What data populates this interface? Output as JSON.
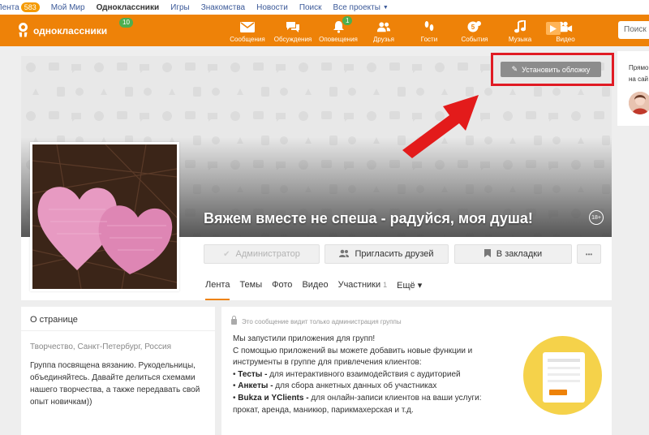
{
  "topbar": {
    "links": [
      "Лента",
      "Мой Мир",
      "Одноклассники",
      "Игры",
      "Знакомства",
      "Новости",
      "Поиск",
      "Все проекты"
    ],
    "feed_count": "583"
  },
  "header": {
    "logo_text": "одноклассники",
    "logo_badge": "10",
    "nav": [
      {
        "label": "Сообщения",
        "icon": "envelope-icon"
      },
      {
        "label": "Обсуждения",
        "icon": "chat-bubbles-icon"
      },
      {
        "label": "Оповещения",
        "icon": "bell-icon",
        "badge": "1"
      },
      {
        "label": "Друзья",
        "icon": "people-icon"
      },
      {
        "label": "Гости",
        "icon": "footprints-icon"
      },
      {
        "label": "События",
        "icon": "events-icon",
        "badge_inline": "5"
      },
      {
        "label": "Музыка",
        "icon": "music-note-icon"
      },
      {
        "label": "Видео",
        "icon": "video-camera-icon"
      }
    ],
    "search_placeholder": "Поиск"
  },
  "cover": {
    "set_cover_label": "Установить обложку",
    "group_title": "Вяжем вместе не спеша - радуйся, моя душа!",
    "age_rating": "18+"
  },
  "actions": {
    "admin_label": "Администратор",
    "invite_label": "Пригласить друзей",
    "bookmark_label": "В закладки",
    "more_label": "•••"
  },
  "tabs": {
    "feed": "Лента",
    "topics": "Темы",
    "photo": "Фото",
    "video": "Видео",
    "members": "Участники",
    "members_count": "1",
    "more": "Ещё ▾"
  },
  "about": {
    "heading": "О странице",
    "location": "Творчество, Санкт-Петербург, Россия",
    "description": "Группа посвящена вязанию. Рукодельницы, объединяйтесь. Давайте делиться схемами нашего творчества, а также передавать свой опыт новичкам))"
  },
  "message": {
    "admin_note": "Это сообщение видит только администрация группы",
    "intro1": "Мы запустили приложения для групп!",
    "intro2": "С помощью приложений вы можете добавить новые функции и инструменты в группе для привлечения клиентов:",
    "item1_bold": "Тесты -",
    "item1_text": " для интерактивного взаимодействия с аудиторией",
    "item2_bold": "Анкеты -",
    "item2_text": " для сбора анкетных данных об участниках",
    "item3_bold": "Bukza и YClients -",
    "item3_text": " для онлайн-записи клиентов на ваши услуги: прокат, аренда, маникюр, парикмахерская и т.д."
  },
  "right_column": {
    "line1": "Прямо",
    "line2": "на сай"
  },
  "colors": {
    "brand_orange": "#ee8208",
    "highlight_red": "#e01b24",
    "link_blue": "#3b5998"
  }
}
